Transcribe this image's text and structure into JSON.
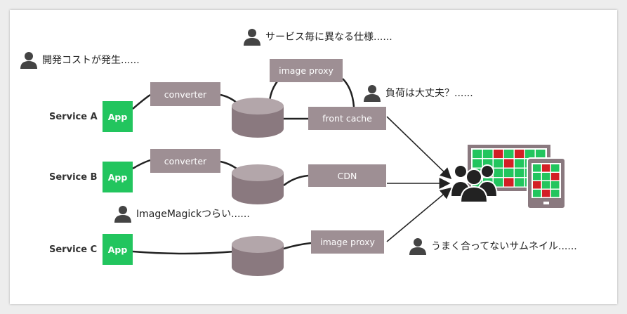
{
  "colors": {
    "box": "#9e8f94",
    "app": "#22c55e",
    "cylinder": "#8a797f",
    "cylinder_top": "#b3a6aa",
    "line": "#222222",
    "cell_green": "#22c55e",
    "cell_red": "#d31f26"
  },
  "services": [
    {
      "label": "Service A",
      "app": "App"
    },
    {
      "label": "Service B",
      "app": "App"
    },
    {
      "label": "Service C",
      "app": "App"
    }
  ],
  "boxes": {
    "converter_a": "converter",
    "converter_b": "converter",
    "image_proxy_top": "image proxy",
    "front_cache": "front cache",
    "cdn": "CDN",
    "image_proxy_c": "image proxy"
  },
  "comments": {
    "cost": "開発コストが発生......",
    "spec": "サービス毎に異なる仕様......",
    "load": "負荷は大丈夫？......",
    "imagemagick": "ImageMagickつらい......",
    "thumbnail": "うまく合ってないサムネイル......"
  },
  "icons": {
    "person": "person-icon",
    "users": "users-group-icon",
    "monitor": "monitor-icon",
    "tablet": "tablet-icon"
  }
}
